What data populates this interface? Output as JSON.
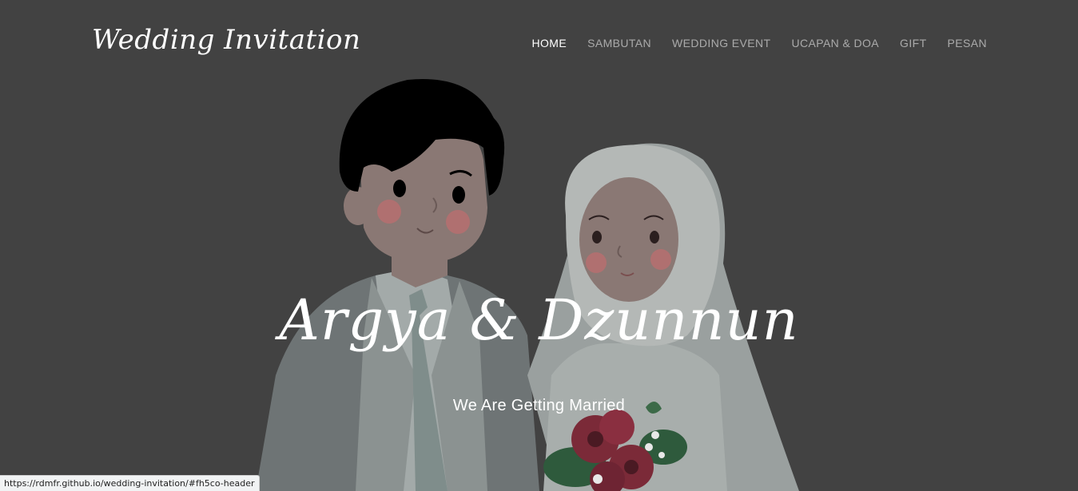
{
  "header": {
    "brand": "Wedding Invitation",
    "nav": [
      {
        "label": "HOME",
        "active": true
      },
      {
        "label": "SAMBUTAN",
        "active": false
      },
      {
        "label": "WEDDING EVENT",
        "active": false
      },
      {
        "label": "UCAPAN & DOA",
        "active": false
      },
      {
        "label": "GIFT",
        "active": false
      },
      {
        "label": "PESAN",
        "active": false
      }
    ]
  },
  "hero": {
    "names": "Argya & Dzunnun",
    "tagline": "We Are Getting Married",
    "illustration": "groom-and-bride-cartoon"
  },
  "status_bar": {
    "url": "https://rdmfr.github.io/wedding-invitation/#fh5co-header"
  },
  "colors": {
    "overlay": "#424242",
    "text": "#ffffff",
    "nav_inactive": "#a8a8a8"
  }
}
